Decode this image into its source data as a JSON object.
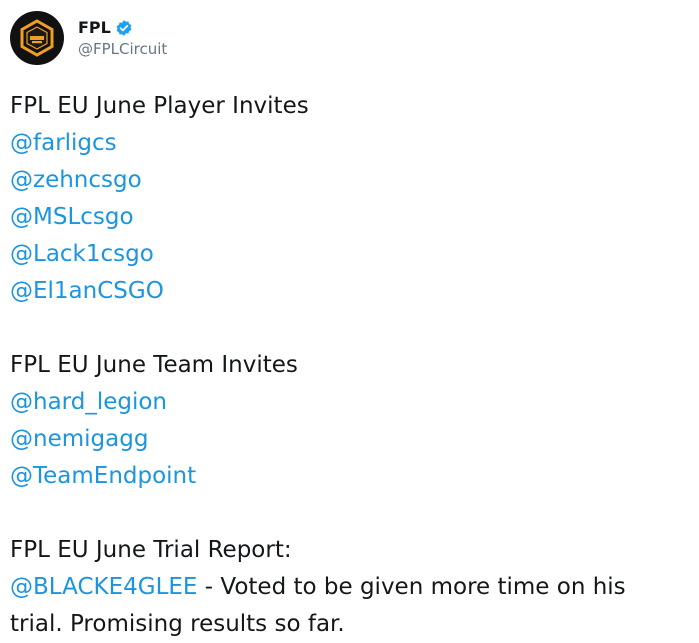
{
  "account": {
    "display_name": "FPL",
    "handle": "@FPLCircuit",
    "verified": true,
    "avatar_icon": "fpl-logo-icon",
    "colors": {
      "avatar_bg": "#111111",
      "logo_orange": "#f0a020",
      "verified_blue": "#1da1f2"
    }
  },
  "tweet": {
    "sections": [
      {
        "heading": "FPL EU June Player Invites",
        "mentions": [
          "@farligcs",
          "@zehncsgo",
          "@MSLcsgo",
          "@Lack1csgo",
          "@El1anCSGO"
        ]
      },
      {
        "heading": "FPL EU June Team Invites",
        "mentions": [
          "@hard_legion",
          "@nemigagg",
          "@TeamEndpoint"
        ]
      }
    ],
    "trial": {
      "heading": "FPL EU June Trial Report:",
      "mention": "@BLACKE4GLEE",
      "text_line1": " - Voted to be given more time on his",
      "text_line2": "trial. Promising results so far."
    }
  },
  "colors": {
    "text": "#14171a",
    "link": "#1b95e0",
    "muted": "#657786"
  }
}
